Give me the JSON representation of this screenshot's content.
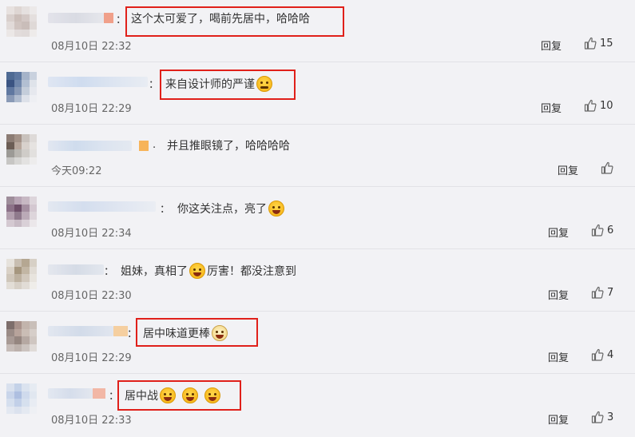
{
  "comments": [
    {
      "id": "c1",
      "text_parts": [
        "这个太可爱了，喝前先居中，哈哈哈"
      ],
      "emojis": [],
      "time": "08月10日 22:32",
      "reply_label": "回复",
      "likes": "15",
      "highlighted": true
    },
    {
      "id": "c2",
      "text_parts": [
        "来自设计师的严谨"
      ],
      "emojis": [
        "laughing-crying-emoji"
      ],
      "time": "08月10日 22:29",
      "reply_label": "回复",
      "likes": "10",
      "highlighted": true
    },
    {
      "id": "c3",
      "text_parts": [
        "并且推眼镜了，哈哈哈哈"
      ],
      "emojis": [],
      "time": "今天09:22",
      "reply_label": "回复",
      "likes": "",
      "highlighted": false
    },
    {
      "id": "c4",
      "text_parts": [
        "你这关注点，亮了"
      ],
      "emojis": [
        "shy-emoji"
      ],
      "time": "08月10日 22:34",
      "reply_label": "回复",
      "likes": "6",
      "highlighted": false
    },
    {
      "id": "c5",
      "text_parts": [
        "姐妹，真相了",
        "厉害！都没注意到"
      ],
      "emojis": [
        "grin-emoji"
      ],
      "time": "08月10日 22:30",
      "reply_label": "回复",
      "likes": "7",
      "highlighted": false
    },
    {
      "id": "c6",
      "text_parts": [
        "居中味道更棒"
      ],
      "emojis": [
        "doge-emoji"
      ],
      "time": "08月10日 22:29",
      "reply_label": "回复",
      "likes": "4",
      "highlighted": true
    },
    {
      "id": "c7",
      "text_parts": [
        "居中战"
      ],
      "emojis": [
        "laughing-emoji",
        "laughing-emoji",
        "laughing-emoji"
      ],
      "time": "08月10日 22:33",
      "reply_label": "回复",
      "likes": "3",
      "highlighted": true
    }
  ],
  "colon": "：",
  "colors": {
    "highlight_border": "#e0201a",
    "background": "#f2f2f5",
    "separator": "#e2e2e6"
  }
}
